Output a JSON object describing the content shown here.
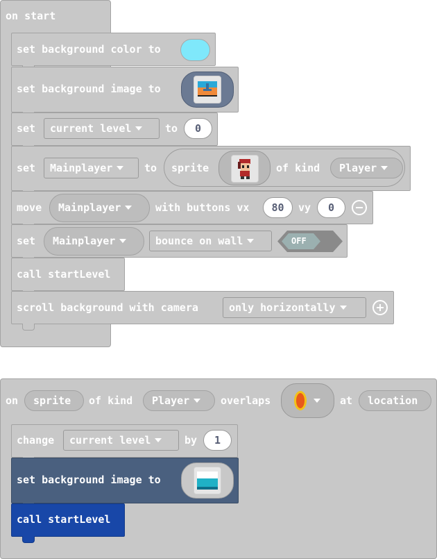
{
  "colors": {
    "block_gray": "#c8c8c8",
    "block_dark": "#4a607f",
    "block_blue": "#1847a8",
    "bg_color_swatch": "#7fe8fb"
  },
  "on_start": {
    "hat_label": "on start",
    "bg_color": {
      "label": "set background color to"
    },
    "bg_image": {
      "label": "set background image to",
      "icon": "landscape-image-icon"
    },
    "set_level": {
      "set": "set",
      "variable": "current level",
      "to": "to",
      "value": "0"
    },
    "set_player": {
      "set": "set",
      "variable": "Mainplayer",
      "to": "to",
      "sprite": "sprite",
      "of_kind": "of kind",
      "kind": "Player",
      "icon": "pixel-hero-sprite-icon"
    },
    "move": {
      "move": "move",
      "variable": "Mainplayer",
      "with_buttons_vx": "with buttons vx",
      "vx": "80",
      "vy_label": "vy",
      "vy": "0"
    },
    "bounce": {
      "set": "set",
      "variable": "Mainplayer",
      "flag": "bounce on wall",
      "toggle": "OFF"
    },
    "call": {
      "label": "call startLevel"
    },
    "scroll": {
      "label": "scroll background with camera",
      "option": "only horizontally"
    }
  },
  "overlap": {
    "on": "on",
    "sprite": "sprite",
    "of_kind": "of kind",
    "kind": "Player",
    "overlaps": "overlaps",
    "tile_icon": "orange-flame-tile-icon",
    "at": "at",
    "location": "location",
    "change": {
      "label": "change",
      "variable": "current level",
      "by": "by",
      "value": "1"
    },
    "bg_image": {
      "label": "set background image to",
      "icon": "water-image-icon"
    },
    "call": {
      "label": "call startLevel"
    }
  }
}
